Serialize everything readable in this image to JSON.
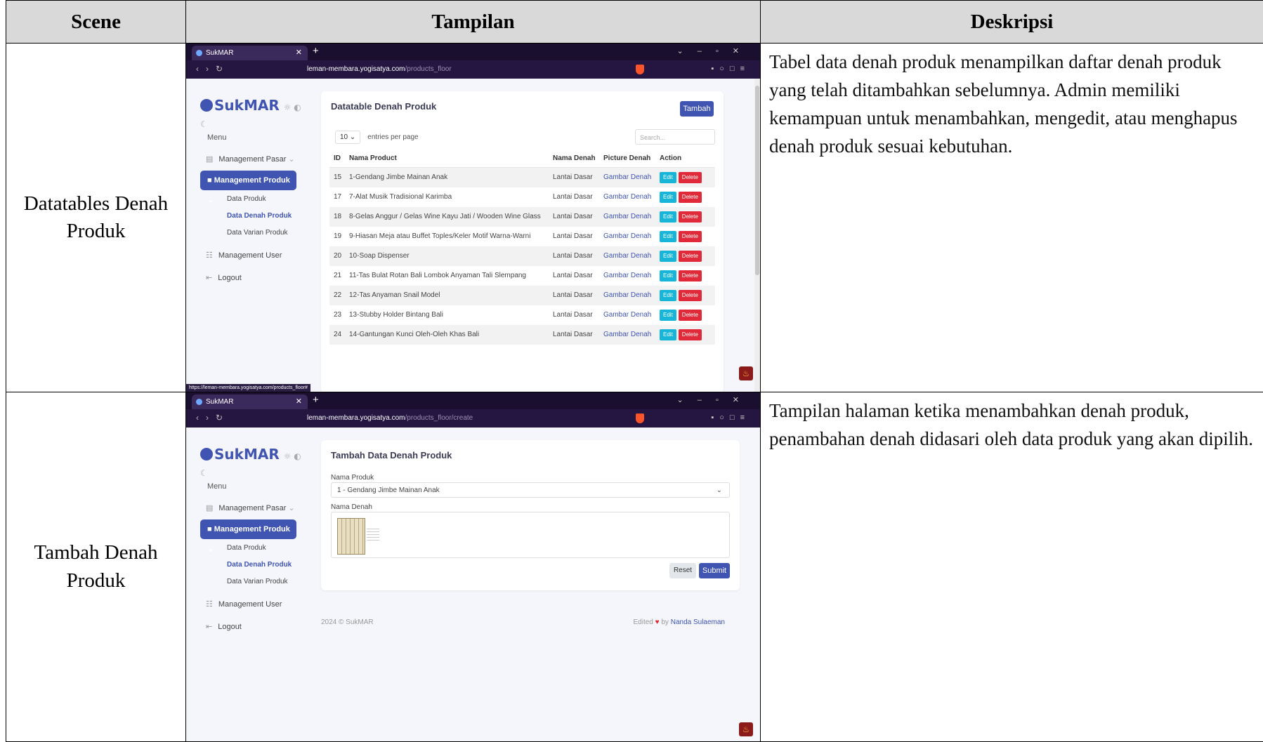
{
  "headers": {
    "scene": "Scene",
    "tampilan": "Tampilan",
    "deskripsi": "Deskripsi"
  },
  "rows": [
    {
      "scene": "Datatables Denah Produk",
      "description": "Tabel data denah produk menampilkan daftar denah produk yang telah ditambahkan sebelumnya. Admin memiliki kemampuan untuk menambahkan, mengedit, atau menghapus denah produk sesuai kebutuhan."
    },
    {
      "scene": "Tambah Denah Produk",
      "description": "Tampilan halaman ketika menambahkan denah produk, penambahan denah didasari oleh data produk yang akan dipilih."
    }
  ],
  "browser": {
    "tab_title": "SukMAR",
    "url_host": "leman-membara.yogisatya.com",
    "url_path_list": "/products_floor",
    "url_path_create": "/products_floor/create",
    "status_url": "https://leman-membara.yogisatya.com/products_floor#"
  },
  "app": {
    "logo": "SukMAR",
    "menu_label": "Menu",
    "menu": {
      "pasar": "Management Pasar",
      "produk": "Management Produk",
      "data_produk": "Data Produk",
      "data_denah": "Data Denah Produk",
      "data_varian": "Data Varian Produk",
      "user": "Management User",
      "logout": "Logout"
    }
  },
  "list_screen": {
    "title": "Datatable Denah Produk",
    "add_button": "Tambah",
    "entries_value": "10",
    "entries_label": "entries per page",
    "search_placeholder": "Search...",
    "columns": [
      "ID",
      "Nama Product",
      "Nama Denah",
      "Picture Denah",
      "Action"
    ],
    "edit_label": "Edit",
    "delete_label": "Delete",
    "rows": [
      {
        "id": "15",
        "name": "1-Gendang Jimbe Mainan Anak",
        "denah": "Lantai Dasar",
        "picture": "Gambar Denah"
      },
      {
        "id": "17",
        "name": "7-Alat Musik Tradisional Karimba",
        "denah": "Lantai Dasar",
        "picture": "Gambar Denah"
      },
      {
        "id": "18",
        "name": "8-Gelas Anggur / Gelas Wine Kayu Jati / Wooden Wine Glass",
        "denah": "Lantai Dasar",
        "picture": "Gambar Denah"
      },
      {
        "id": "19",
        "name": "9-Hiasan Meja atau Buffet Toples/Keler Motif Warna-Warni",
        "denah": "Lantai Dasar",
        "picture": "Gambar Denah"
      },
      {
        "id": "20",
        "name": "10-Soap Dispenser",
        "denah": "Lantai Dasar",
        "picture": "Gambar Denah"
      },
      {
        "id": "21",
        "name": "11-Tas Bulat Rotan Bali Lombok Anyaman Tali Slempang",
        "denah": "Lantai Dasar",
        "picture": "Gambar Denah"
      },
      {
        "id": "22",
        "name": "12-Tas Anyaman Snail Model",
        "denah": "Lantai Dasar",
        "picture": "Gambar Denah"
      },
      {
        "id": "23",
        "name": "13-Stubby Holder Bintang Bali",
        "denah": "Lantai Dasar",
        "picture": "Gambar Denah"
      },
      {
        "id": "24",
        "name": "14-Gantungan Kunci Oleh-Oleh Khas Bali",
        "denah": "Lantai Dasar",
        "picture": "Gambar Denah"
      }
    ]
  },
  "create_screen": {
    "title": "Tambah Data Denah Produk",
    "label_produk": "Nama Produk",
    "selected_produk": "1 - Gendang Jimbe Mainan Anak",
    "label_denah": "Nama Denah",
    "reset": "Reset",
    "submit": "Submit",
    "footer_left": "2024 © SukMAR",
    "footer_edited": "Edited",
    "footer_by": "by",
    "footer_name": "Nanda Sulaeman"
  }
}
